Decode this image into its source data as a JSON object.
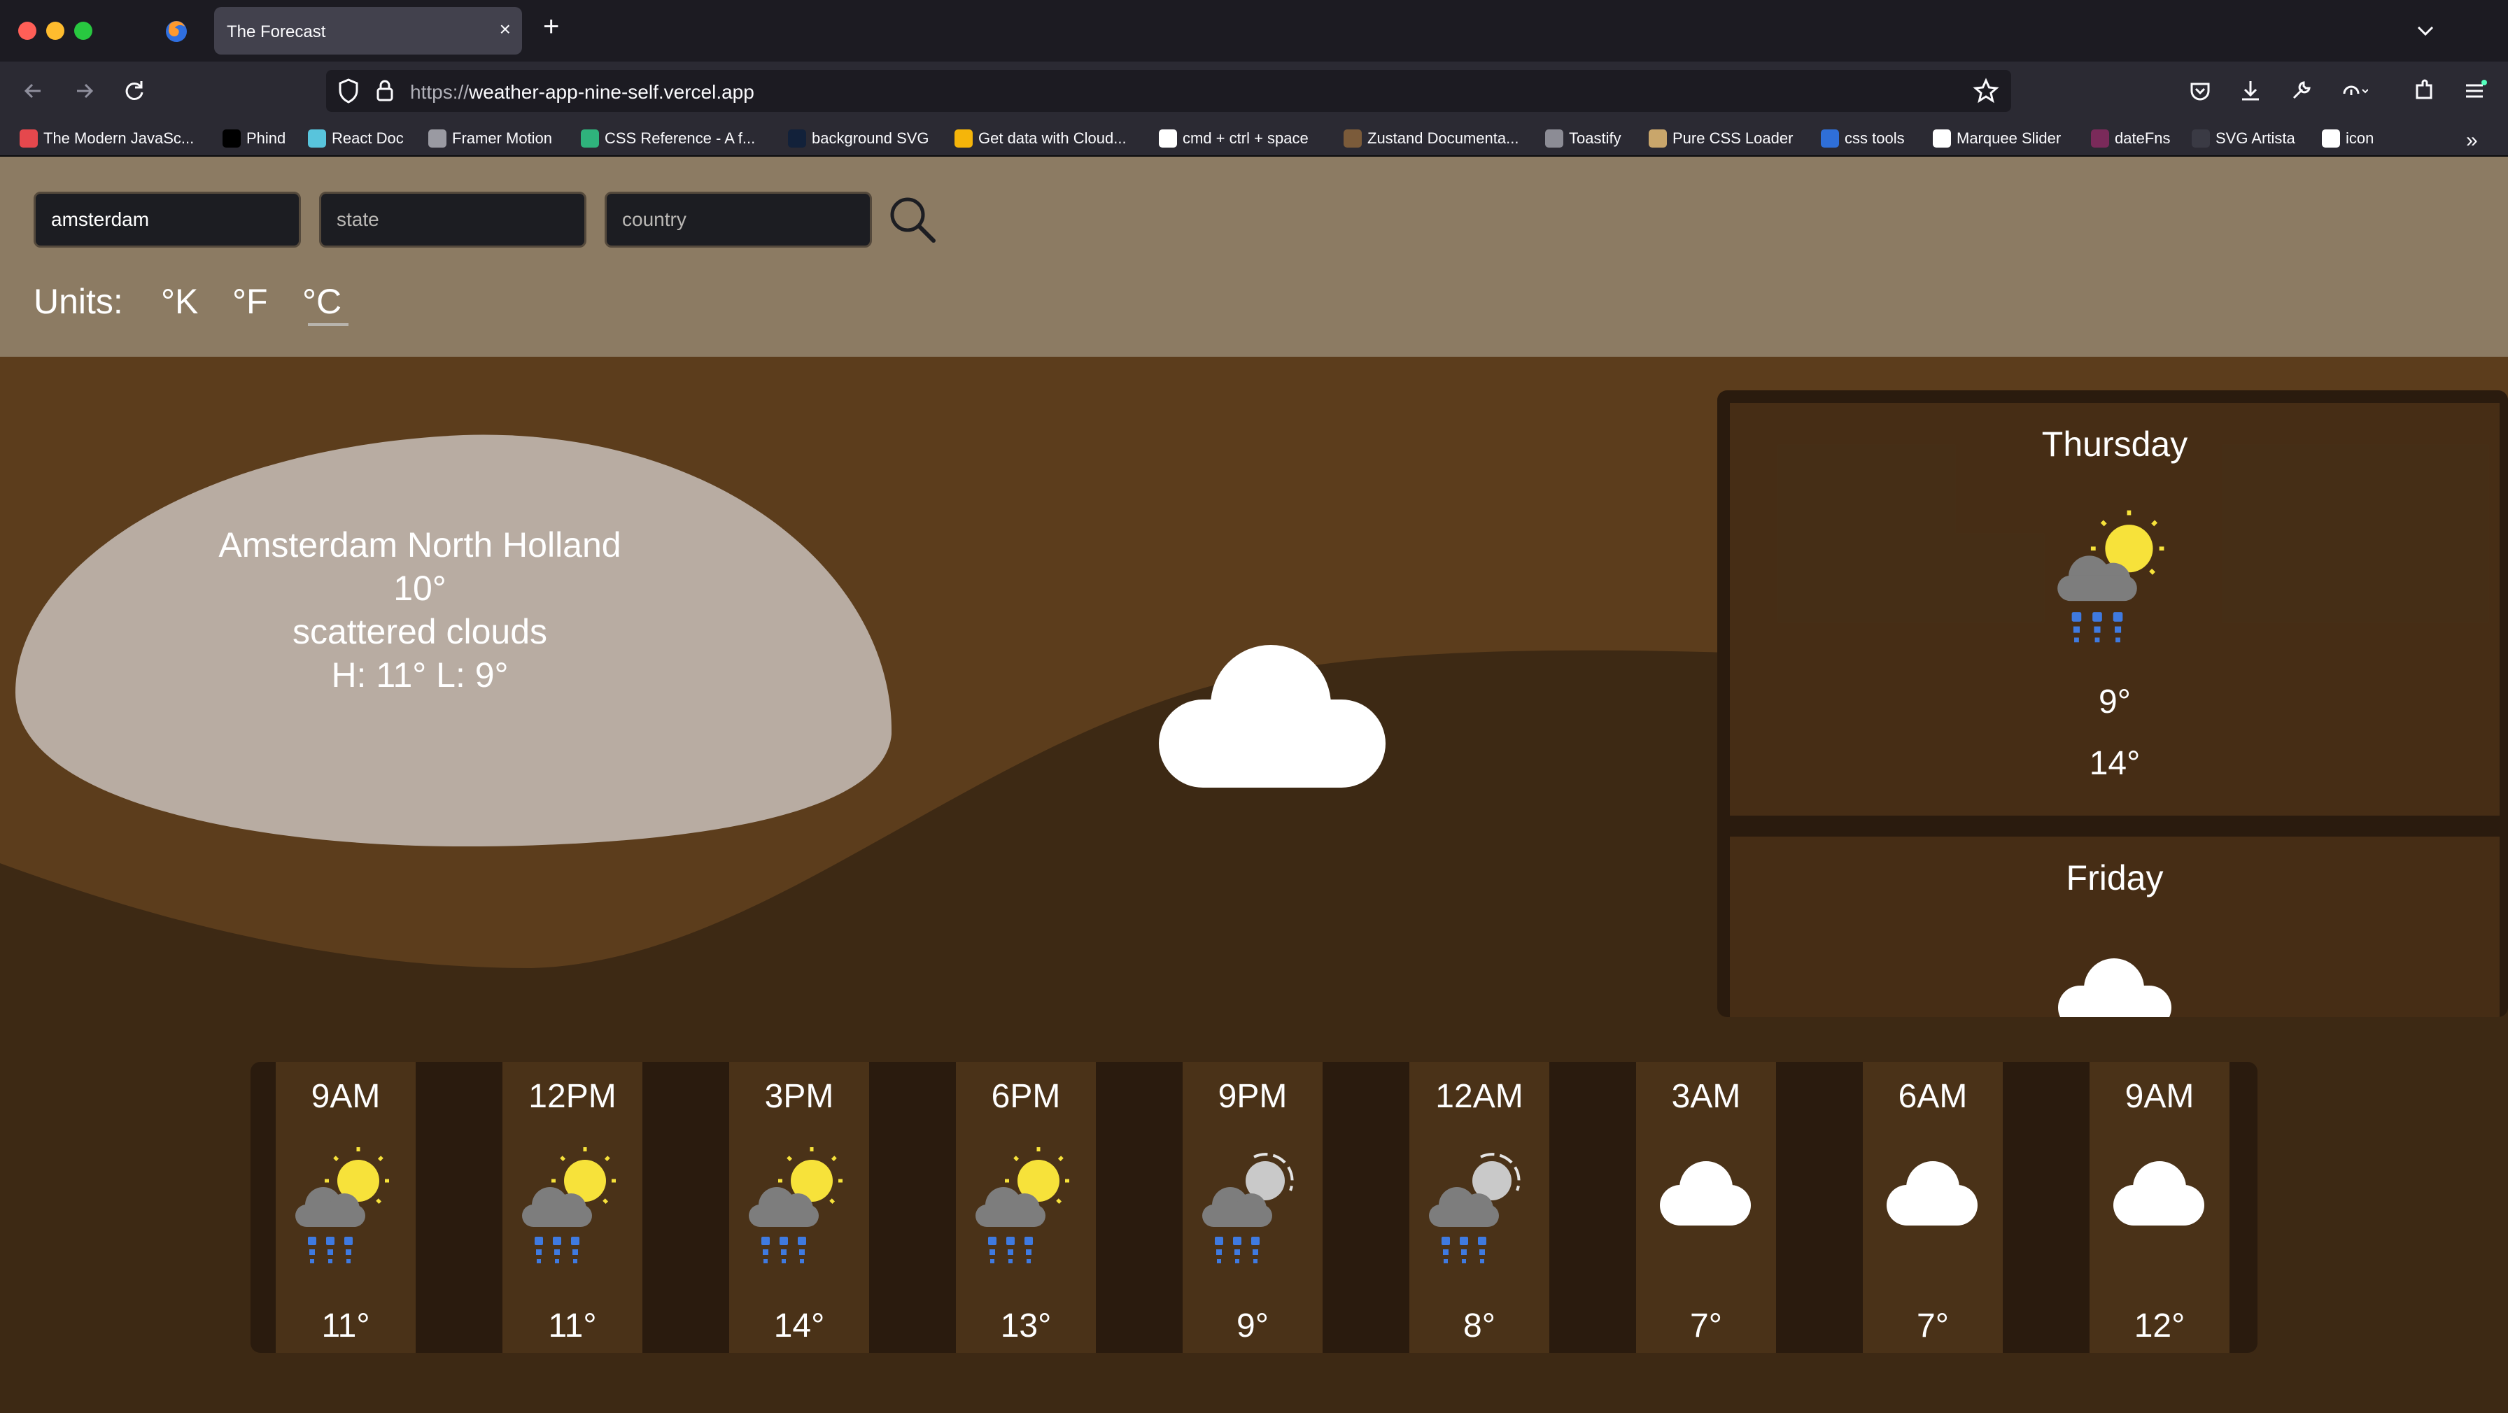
{
  "browser": {
    "tab_title": "The Forecast",
    "url_protocol": "https://",
    "url_host": "weather-app-nine-self.vercel.app",
    "bookmarks": [
      {
        "label": "The Modern JavaSc...",
        "icon": "js-icon",
        "color": "#e5484d"
      },
      {
        "label": "Phind",
        "icon": "phind-icon",
        "color": "#000000"
      },
      {
        "label": "React Doc",
        "icon": "react-icon",
        "color": "#58c4dc"
      },
      {
        "label": "Framer Motion",
        "icon": "globe-icon",
        "color": "#9a9aa2"
      },
      {
        "label": "CSS Reference - A f...",
        "icon": "css-icon",
        "color": "#2fb37c"
      },
      {
        "label": "background SVG",
        "icon": "circle-icon",
        "color": "#12213a"
      },
      {
        "label": "Get data with Cloud...",
        "icon": "firebase-icon",
        "color": "#f5b50a"
      },
      {
        "label": "cmd + ctrl + space",
        "icon": "google-icon",
        "color": "#ffffff"
      },
      {
        "label": "Zustand Documenta...",
        "icon": "zustand-icon",
        "color": "#7b5b3a"
      },
      {
        "label": "Toastify",
        "icon": "toast-icon",
        "color": "#8c8c95"
      },
      {
        "label": "Pure CSS Loader",
        "icon": "loader-icon",
        "color": "#c9a66b"
      },
      {
        "label": "css tools",
        "icon": "code-icon",
        "color": "#2f6fd8"
      },
      {
        "label": "Marquee Slider",
        "icon": "github-icon",
        "color": "#ffffff"
      },
      {
        "label": "dateFns",
        "icon": "datefns-icon",
        "color": "#7a2a5a"
      },
      {
        "label": "SVG Artista",
        "icon": "triangle-icon",
        "color": "#3a3a44"
      },
      {
        "label": "icon",
        "icon": "icon-icon",
        "color": "#ffffff"
      }
    ]
  },
  "search": {
    "city_value": "amsterdam",
    "state_placeholder": "state",
    "country_placeholder": "country"
  },
  "units": {
    "label": "Units:",
    "kelvin": "°K",
    "fahrenheit": "°F",
    "celsius": "°C",
    "selected": "celsius"
  },
  "current": {
    "location": "Amsterdam North Holland",
    "temp": "10°",
    "description": "scattered clouds",
    "high_low": "H: 11° L: 9°",
    "icon": "cloud-icon"
  },
  "daily": [
    {
      "day": "Thursday",
      "icon": "sun-cloud-rain-icon",
      "low": "9°",
      "high": "14°"
    },
    {
      "day": "Friday",
      "icon": "cloud-icon"
    }
  ],
  "hourly": [
    {
      "time": "9AM",
      "icon": "sun-cloud-rain-icon",
      "temp": "11°"
    },
    {
      "time": "12PM",
      "icon": "sun-cloud-rain-icon",
      "temp": "11°"
    },
    {
      "time": "3PM",
      "icon": "sun-cloud-rain-icon",
      "temp": "14°"
    },
    {
      "time": "6PM",
      "icon": "sun-cloud-rain-icon",
      "temp": "13°"
    },
    {
      "time": "9PM",
      "icon": "moon-cloud-rain-icon",
      "temp": "9°"
    },
    {
      "time": "12AM",
      "icon": "moon-cloud-rain-icon",
      "temp": "8°"
    },
    {
      "time": "3AM",
      "icon": "cloud-icon",
      "temp": "7°"
    },
    {
      "time": "6AM",
      "icon": "cloud-icon",
      "temp": "7°"
    },
    {
      "time": "9AM",
      "icon": "cloud-icon",
      "temp": "12°"
    }
  ],
  "colors": {
    "header_bg": "#8c7b63",
    "page_bg": "#5c3d1c",
    "hill_dark": "#3d2914",
    "panel_bg": "#2a1b0e",
    "card_bg": "#4a3218",
    "blob": "#b8aca2",
    "sun": "#f7e23a",
    "cloud_gray": "#7d7d7d",
    "rain": "#3f7ae0"
  }
}
